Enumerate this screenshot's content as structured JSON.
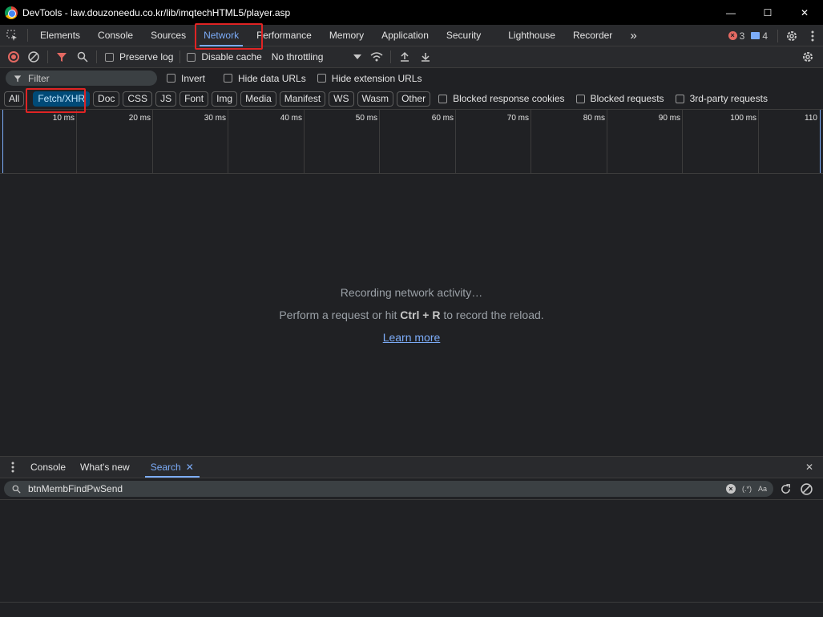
{
  "window": {
    "title": "DevTools - law.douzoneedu.co.kr/lib/imqtechHTML5/player.asp",
    "minimize": "—",
    "maximize": "☐",
    "close": "✕"
  },
  "main_tabs": [
    "Elements",
    "Console",
    "Sources",
    "Network",
    "Performance",
    "Memory",
    "Application",
    "Security",
    "Lighthouse",
    "Recorder"
  ],
  "active_tab": "Network",
  "more_tabs": "»",
  "counts": {
    "errors": "3",
    "messages": "4"
  },
  "network_toolbar": {
    "preserve_log": "Preserve log",
    "disable_cache": "Disable cache",
    "throttling": "No throttling"
  },
  "filter": {
    "placeholder": "Filter",
    "invert": "Invert",
    "hide_data_urls": "Hide data URLs",
    "hide_extension_urls": "Hide extension URLs"
  },
  "type_filters": [
    "All",
    "Fetch/XHR",
    "Doc",
    "CSS",
    "JS",
    "Font",
    "Img",
    "Media",
    "Manifest",
    "WS",
    "Wasm",
    "Other"
  ],
  "active_type_filter": "Fetch/XHR",
  "extra_filters": {
    "blocked_response_cookies": "Blocked response cookies",
    "blocked_requests": "Blocked requests",
    "third_party": "3rd-party requests"
  },
  "timeline_ticks": [
    "10 ms",
    "20 ms",
    "30 ms",
    "40 ms",
    "50 ms",
    "60 ms",
    "70 ms",
    "80 ms",
    "90 ms",
    "100 ms",
    "110"
  ],
  "empty_state": {
    "recording": "Recording network activity…",
    "hint_prefix": "Perform a request or hit ",
    "hint_shortcut": "Ctrl + R",
    "hint_suffix": " to record the reload.",
    "learn_more": "Learn more"
  },
  "drawer": {
    "tabs": [
      "Console",
      "What's new",
      "Search"
    ],
    "active_tab": "Search",
    "search_value": "btnMembFindPwSend",
    "regex_label": "(.*)",
    "case_label": "Aa"
  },
  "colors": {
    "accent": "#7cacf8",
    "highlight": "#e02424",
    "error": "#e46962",
    "chip_active": "#004a77"
  }
}
